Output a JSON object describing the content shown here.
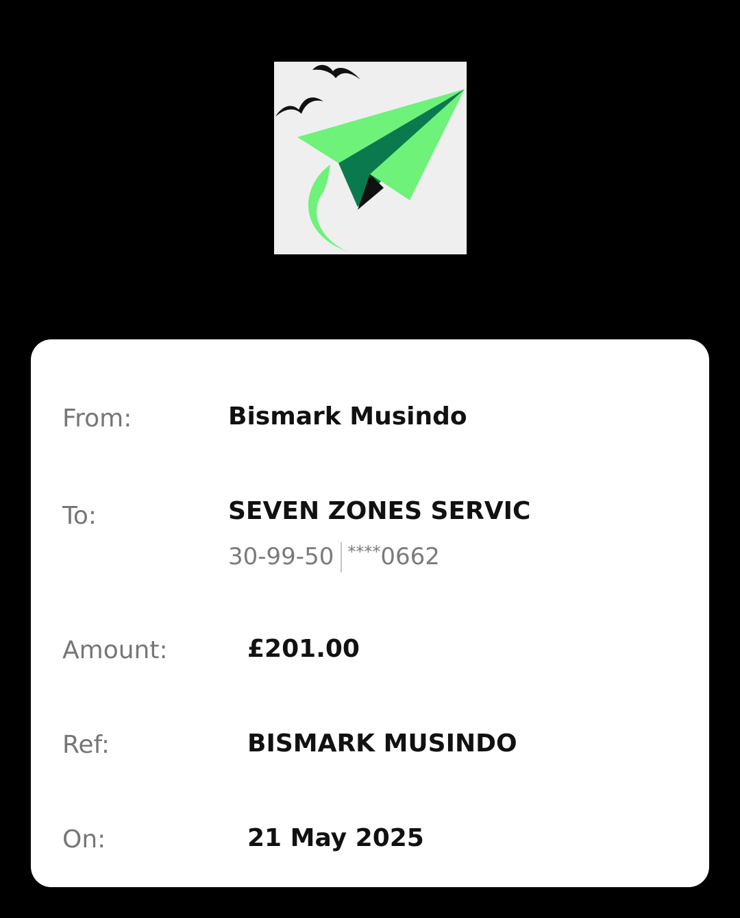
{
  "logo": {
    "icon": "paper-plane-logo-icon",
    "colors": {
      "light_green": "#6ef27a",
      "dark_green": "#0a7a4e",
      "background": "#efefef"
    }
  },
  "details": {
    "from": {
      "label": "From:",
      "value": "Bismark Musindo"
    },
    "to": {
      "label": "To:",
      "value": "SEVEN ZONES SERVIC",
      "sort_code": "30-99-50",
      "account_mask": "****",
      "account_last4": "0662"
    },
    "amount": {
      "label": "Amount:",
      "value": "£201.00"
    },
    "ref": {
      "label": "Ref:",
      "value": "BISMARK MUSINDO"
    },
    "on": {
      "label": "On:",
      "value": "21 May 2025"
    }
  }
}
